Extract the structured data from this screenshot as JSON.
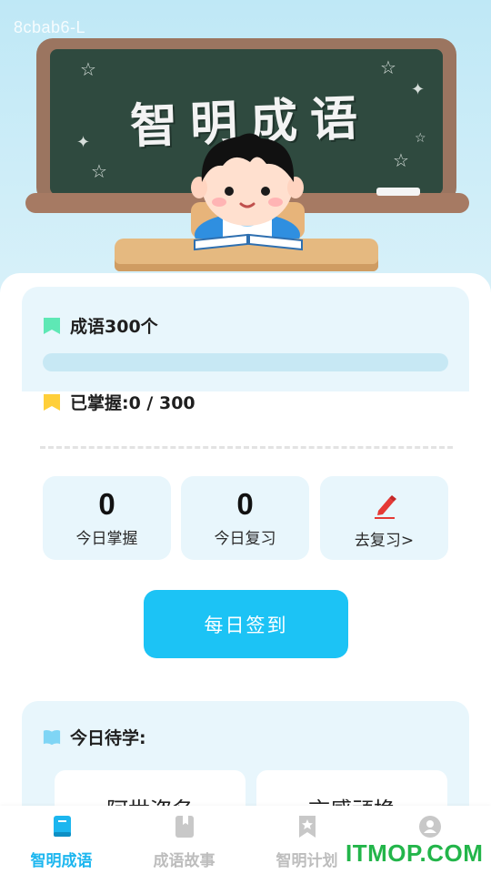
{
  "device_id": "8cbab6-L",
  "hero": {
    "board_title": "智明成语"
  },
  "progress": {
    "total_label": "成语300个",
    "mastered_label": "已掌握:0 / 300",
    "fraction": 0,
    "colors": {
      "track": "#c7e8f4",
      "fill": "#23c3f3",
      "flag_total": "#5ee8b5",
      "flag_mastered": "#ffcf3a"
    }
  },
  "stats": [
    {
      "value": "0",
      "label": "今日掌握"
    },
    {
      "value": "0",
      "label": "今日复习"
    }
  ],
  "review": {
    "label": "去复习>",
    "icon": "pencil-icon"
  },
  "checkin": {
    "label": "每日签到",
    "color": "#1cc3f5"
  },
  "todo": {
    "title": "今日待学:",
    "idioms": [
      "阿世盗名",
      "言感顽换"
    ]
  },
  "nav": {
    "items": [
      {
        "label": "智明成语",
        "icon": "book-icon",
        "active": true
      },
      {
        "label": "成语故事",
        "icon": "bookmark-book-icon",
        "active": false
      },
      {
        "label": "智明计划",
        "icon": "star-bookmark-icon",
        "active": false
      },
      {
        "label": "",
        "icon": "user-icon",
        "active": false
      }
    ],
    "active_color": "#1cb6ef"
  },
  "site_watermark": "ITMOP.COM"
}
